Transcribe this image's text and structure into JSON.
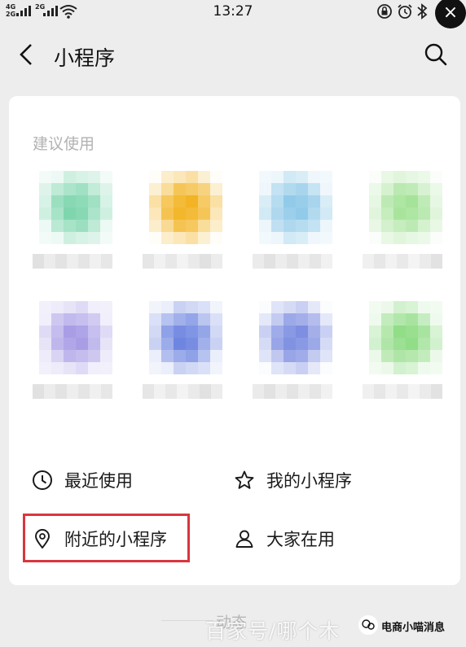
{
  "status_bar": {
    "network_top": "4G",
    "network_bottom": "2G",
    "network_top2": "2G",
    "time": "13:27",
    "icons": [
      "signal-icon",
      "wifi-icon",
      "screen-lock-icon",
      "alarm-icon",
      "bluetooth-icon",
      "battery-icon"
    ]
  },
  "nav": {
    "title": "小程序",
    "back_icon": "chevron-left-icon",
    "search_icon": "search-icon"
  },
  "suggest": {
    "title": "建议使用",
    "apps": [
      {
        "name": "app-1",
        "color": "#7fd6ae"
      },
      {
        "name": "app-2",
        "color": "#f2b21e"
      },
      {
        "name": "app-3",
        "color": "#8fc9e8"
      },
      {
        "name": "app-4",
        "color": "#a6e39a"
      },
      {
        "name": "app-5",
        "color": "#a99ee6"
      },
      {
        "name": "app-6",
        "color": "#6f86e0"
      },
      {
        "name": "app-7",
        "color": "#7a8be0"
      },
      {
        "name": "app-8",
        "color": "#8fdc84"
      }
    ]
  },
  "menu": {
    "recent": "最近使用",
    "mine": "我的小程序",
    "nearby": "附近的小程序",
    "popular": "大家在用",
    "highlight_color": "#d9363e"
  },
  "footer": {
    "section": "动态",
    "watermark": "百家号/哪个木",
    "watermark_brand": "电商小喵消息"
  }
}
